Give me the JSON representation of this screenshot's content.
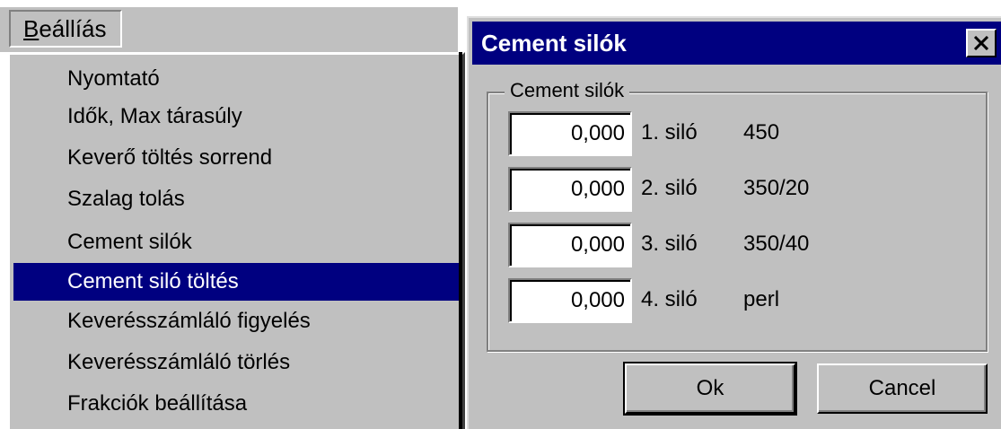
{
  "menu": {
    "title_first": "B",
    "title_rest": "eállíás",
    "items": [
      {
        "label": "Nyomtató"
      },
      {
        "label": "Idők, Max tárasúly"
      },
      {
        "label": "Keverő töltés sorrend"
      },
      {
        "label": "Szalag tolás"
      },
      {
        "label": "Cement silók"
      },
      {
        "label": "Cement siló töltés"
      },
      {
        "label": "Keverésszámláló figyelés"
      },
      {
        "label": "Keverésszámláló törlés"
      },
      {
        "label": "Frakciók beállítása"
      }
    ],
    "selected_index": 5
  },
  "dialog": {
    "title": "Cement silók",
    "group_label": "Cement silók",
    "silos": [
      {
        "value": "0,000",
        "label": "1. siló",
        "type": "450"
      },
      {
        "value": "0,000",
        "label": "2. siló",
        "type": "350/20"
      },
      {
        "value": "0,000",
        "label": "3. siló",
        "type": "350/40"
      },
      {
        "value": "0,000",
        "label": "4. siló",
        "type": "perl"
      }
    ],
    "ok_label": "Ok",
    "cancel_label": "Cancel"
  },
  "colors": {
    "window_face": "#c0c0c0",
    "selection": "#000080",
    "titlebar": "#000080"
  },
  "icons": {
    "close": "close-icon"
  }
}
